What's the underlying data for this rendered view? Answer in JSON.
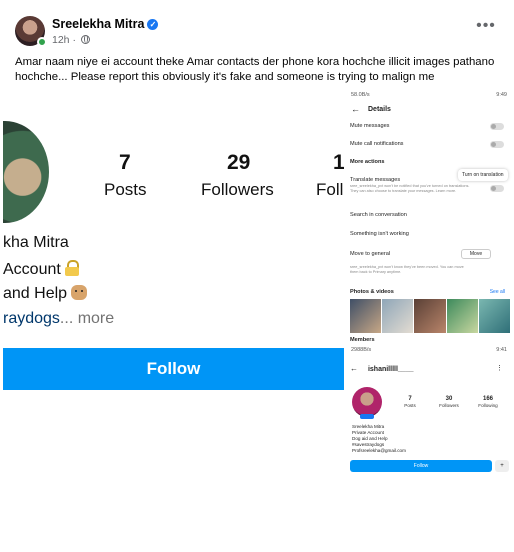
{
  "post": {
    "author": "Sreelekha Mitra",
    "time": "12h",
    "more_icon": "ellipsis-horizontal-icon",
    "caption": "Amar naam niye ei account theke Amar contacts der phone kora hochche illicit images pathano hochche... Please report this obviously it's fake and someone is trying to malign me"
  },
  "crop": {
    "stats": [
      {
        "num": "7",
        "label": "Posts"
      },
      {
        "num": "29",
        "label": "Followers"
      },
      {
        "num": "1",
        "label": "Foll"
      }
    ],
    "bio": [
      "kha Mitra",
      "Account",
      "and Help",
      "raydogs"
    ],
    "bio_more": "... more",
    "follow": "Follow"
  },
  "details": {
    "status_left": "58.0B/s",
    "status_right": "9:49",
    "title": "Details",
    "mute_messages": "Mute messages",
    "mute_calls": "Mute call notifications",
    "more_actions": "More actions",
    "translate": "Translate messages",
    "translate_note": "sree_sreelekha_pvt won't be notified that you've turned on translations. They can also choose to translate your messages. Learn more.",
    "tooltip": "Turn on translation",
    "search": "Search in conversation",
    "something": "Something isn't working",
    "move_general": "Move to general",
    "move_btn": "Move",
    "move_note": "sree_sreelekha_pvt won't know they've been moved. You can move them back to Primary anytime.",
    "photos": "Photos & videos",
    "see_all": "See all",
    "members": "Members"
  },
  "profile": {
    "status_left": "2988B/s",
    "status_right": "9:41",
    "username": "ishanilllll____",
    "stats": [
      {
        "num": "7",
        "label": "Posts"
      },
      {
        "num": "30",
        "label": "Followers"
      },
      {
        "num": "166",
        "label": "Following"
      }
    ],
    "bio": [
      "Sreelekha Mitra",
      "Private Account",
      "Dog aid and Help",
      "#savestraydogs",
      "Profsreelekha@gmail.com"
    ],
    "follow": "Follow"
  },
  "colors": {
    "instagram_blue": "#0095f6",
    "facebook_blue": "#1877f2",
    "online_green": "#31a24c"
  }
}
